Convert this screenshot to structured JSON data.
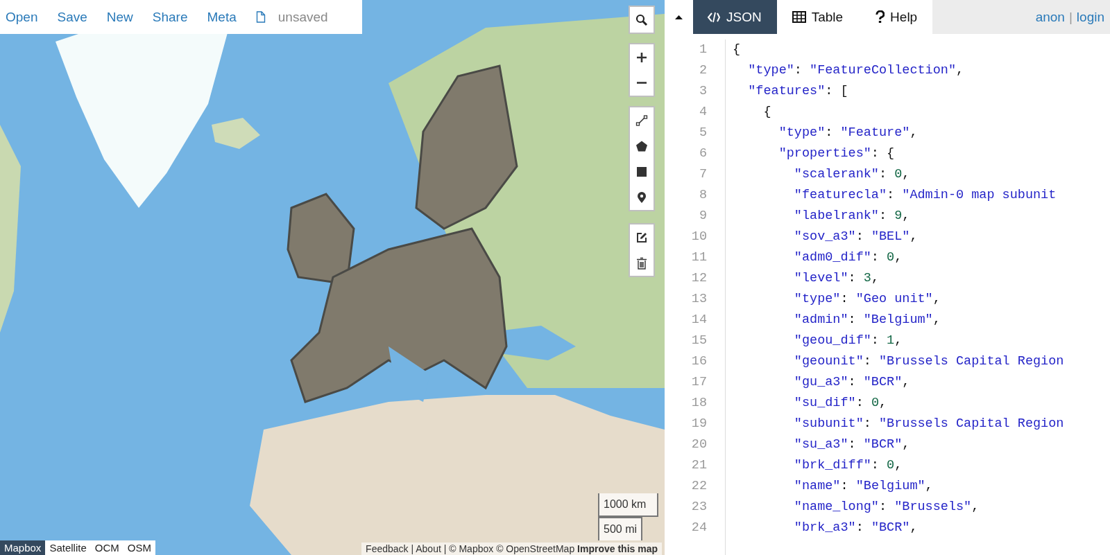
{
  "toolbar": {
    "items": [
      {
        "label": "Open"
      },
      {
        "label": "Save"
      },
      {
        "label": "New"
      },
      {
        "label": "Share"
      },
      {
        "label": "Meta"
      }
    ],
    "file_status": "unsaved"
  },
  "map": {
    "kind": "picture",
    "scale": [
      "1000 km",
      "500 mi"
    ],
    "layers": [
      {
        "label": "Mapbox",
        "selected": true
      },
      {
        "label": "Satellite",
        "selected": false
      },
      {
        "label": "OCM",
        "selected": false
      },
      {
        "label": "OSM",
        "selected": false
      }
    ],
    "attribution": "Feedback | About | © Mapbox © OpenStreetMap **Improve this map**"
  },
  "panel": {
    "tabs": [
      {
        "label": "JSON",
        "selected": true
      },
      {
        "label": "Table",
        "selected": false
      },
      {
        "label": "Help",
        "selected": false
      }
    ],
    "user": {
      "name": "anon",
      "separator": "|",
      "login": "login"
    },
    "editor": {
      "lines": [
        {
          "number": "1",
          "text": "{"
        },
        {
          "number": "2",
          "text": "  \"type\": \"FeatureCollection\","
        },
        {
          "number": "3",
          "text": "  \"features\": ["
        },
        {
          "number": "4",
          "text": "    {"
        },
        {
          "number": "5",
          "text": "      \"type\": \"Feature\","
        },
        {
          "number": "6",
          "text": "      \"properties\": {"
        },
        {
          "number": "7",
          "text": "        \"scalerank\": 0,"
        },
        {
          "number": "8",
          "text": "        \"featurecla\": \"Admin-0 map subunit"
        },
        {
          "number": "9",
          "text": "        \"labelrank\": 9,"
        },
        {
          "number": "10",
          "text": "        \"sov_a3\": \"BEL\","
        },
        {
          "number": "11",
          "text": "        \"adm0_dif\": 0,"
        },
        {
          "number": "12",
          "text": "        \"level\": 3,"
        },
        {
          "number": "13",
          "text": "        \"type\": \"Geo unit\","
        },
        {
          "number": "14",
          "text": "        \"admin\": \"Belgium\","
        },
        {
          "number": "15",
          "text": "        \"geou_dif\": 1,"
        },
        {
          "number": "16",
          "text": "        \"geounit\": \"Brussels Capital Region"
        },
        {
          "number": "17",
          "text": "        \"gu_a3\": \"BCR\","
        },
        {
          "number": "18",
          "text": "        \"su_dif\": 0,"
        },
        {
          "number": "19",
          "text": "        \"subunit\": \"Brussels Capital Region"
        },
        {
          "number": "20",
          "text": "        \"su_a3\": \"BCR\","
        },
        {
          "number": "21",
          "text": "        \"brk_diff\": 0,"
        },
        {
          "number": "22",
          "text": "        \"name\": \"Belgium\","
        },
        {
          "number": "23",
          "text": "        \"name_long\": \"Brussels\","
        },
        {
          "number": "24",
          "text": "        \"brk_a3\": \"BCR\","
        }
      ]
    }
  }
}
